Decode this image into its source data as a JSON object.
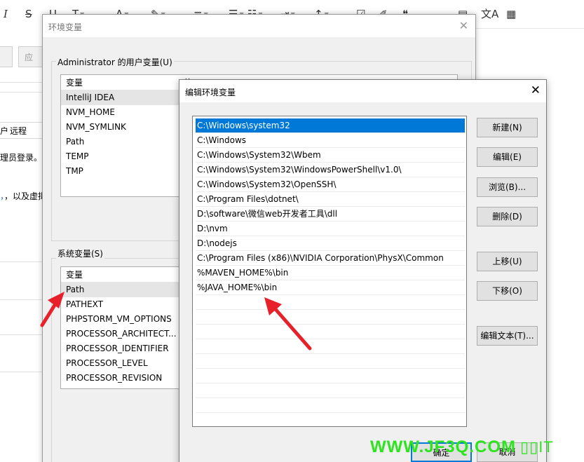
{
  "toolbar": {
    "italic": "I",
    "strike": "S",
    "underline": "U"
  },
  "background": {
    "tab_remote": "远程",
    "tab_fragment": "户",
    "line1": "理员登录。",
    "line2": "，以及虚拟"
  },
  "env_window": {
    "title": "环境变量",
    "user_group_label": "Administrator 的用户变量(U)",
    "user_vars_header": "变量",
    "user_vars_value_header": "值",
    "user_vars": [
      "IntelliJ IDEA",
      "NVM_HOME",
      "NVM_SYMLINK",
      "Path",
      "TEMP",
      "TMP"
    ],
    "system_group_label": "系统变量(S)",
    "system_vars_header": "变量",
    "system_vars": [
      "Path",
      "PATHEXT",
      "PHPSTORM_VM_OPTIONS",
      "PROCESSOR_ARCHITECT...",
      "PROCESSOR_IDENTIFIER",
      "PROCESSOR_LEVEL",
      "PROCESSOR_REVISION"
    ]
  },
  "edit_dialog": {
    "title": "编辑环境变量",
    "paths": [
      "C:\\Windows\\system32",
      "C:\\Windows",
      "C:\\Windows\\System32\\Wbem",
      "C:\\Windows\\System32\\WindowsPowerShell\\v1.0\\",
      "C:\\Windows\\System32\\OpenSSH\\",
      "C:\\Program Files\\dotnet\\",
      "D:\\software\\微信web开发者工具\\dll",
      "D:\\nvm",
      "D:\\nodejs",
      "C:\\Program Files (x86)\\NVIDIA Corporation\\PhysX\\Common",
      "%MAVEN_HOME%\\bin",
      "%JAVA_HOME%\\bin"
    ],
    "buttons": {
      "new": "新建(N)",
      "edit": "编辑(E)",
      "browse": "浏览(B)...",
      "delete": "删除(D)",
      "move_up": "上移(U)",
      "move_down": "下移(O)",
      "edit_text": "编辑文本(T)...",
      "ok": "确定",
      "cancel": "取消"
    }
  },
  "watermark": "WWW.JF3Q.COM",
  "colors": {
    "selection": "#0078d7",
    "arrow": "#e8202a",
    "watermark": "#2ee31f"
  }
}
